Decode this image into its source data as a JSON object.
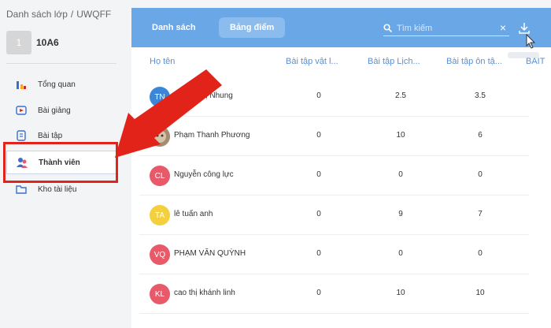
{
  "breadcrumb": {
    "parent": "Danh sách lớp",
    "sep": "/",
    "code": "UWQFF"
  },
  "class_info": {
    "number": "1",
    "name": "10A6"
  },
  "nav": [
    {
      "label": "Tổng quan",
      "icon": "chart-icon"
    },
    {
      "label": "Bài giảng",
      "icon": "video-icon"
    },
    {
      "label": "Bài tập",
      "icon": "document-icon"
    },
    {
      "label": "Thành viên",
      "icon": "members-icon",
      "active": true
    },
    {
      "label": "Kho tài liệu",
      "icon": "folder-icon"
    }
  ],
  "tabs": {
    "list": "Danh sách",
    "grades": "Bảng điểm"
  },
  "search": {
    "placeholder": "Tìm kiếm",
    "clear": "×"
  },
  "columns": [
    "Họ tên",
    "Bài tập vật l...",
    "Bài tập Lịch...",
    "Bài tập ôn tậ...",
    "BAIT"
  ],
  "students": [
    {
      "initials": "TN",
      "name": "Phạm Thị Nhung",
      "scores": [
        "0",
        "2.5",
        "3.5"
      ],
      "color": "#3a86d8"
    },
    {
      "initials": "",
      "name": "Phạm Thanh Phương",
      "scores": [
        "0",
        "10",
        "6"
      ],
      "color": "#b8a58e",
      "photo": true
    },
    {
      "initials": "CL",
      "name": "Nguyễn công lực",
      "scores": [
        "0",
        "0",
        "0"
      ],
      "color": "#e85a6a"
    },
    {
      "initials": "TA",
      "name": "lê tuấn anh",
      "scores": [
        "0",
        "9",
        "7"
      ],
      "color": "#f4d03f"
    },
    {
      "initials": "VQ",
      "name": "PHẠM VĂN QUỲNH",
      "scores": [
        "0",
        "0",
        "0"
      ],
      "color": "#e85a6a"
    },
    {
      "initials": "KL",
      "name": "cao thị khánh linh",
      "scores": [
        "0",
        "10",
        "10"
      ],
      "color": "#e85a6a"
    }
  ],
  "colors": {
    "header": "#6aa7e6",
    "accent": "#5b8fd1",
    "highlight": "#e2231a"
  }
}
